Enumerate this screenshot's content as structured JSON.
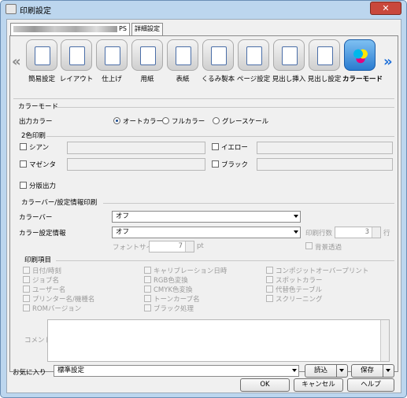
{
  "window": {
    "title": "印刷設定",
    "close_label": "✕"
  },
  "tabs": [
    {
      "label": "PS"
    },
    {
      "label": "詳細設定"
    }
  ],
  "icon_bar": {
    "items": [
      {
        "label": "簡易設定"
      },
      {
        "label": "レイアウト"
      },
      {
        "label": "仕上げ"
      },
      {
        "label": "用紙"
      },
      {
        "label": "表紙"
      },
      {
        "label": "くるみ製本"
      },
      {
        "label": "ページ設定"
      },
      {
        "label": "見出し挿入"
      },
      {
        "label": "見出し設定"
      },
      {
        "label": "カラーモード",
        "selected": true
      }
    ],
    "left_arrow": "«",
    "right_arrow": "»"
  },
  "color_mode": {
    "section": "カラーモード",
    "output_label": "出力カラー",
    "options": [
      "オートカラー",
      "フルカラー",
      "グレースケール"
    ],
    "selected": "オートカラー"
  },
  "two_color": {
    "section": "2色印刷",
    "cyan": "シアン",
    "yellow": "イエロー",
    "magenta": "マゼンタ",
    "black": "ブラック"
  },
  "split_output": "分版出力",
  "colorbar": {
    "section": "カラーバー/設定情報印刷",
    "bar_label": "カラーバー",
    "bar_value": "オフ",
    "info_label": "カラー設定情報",
    "info_value": "オフ",
    "lines_label": "印刷行数",
    "lines_value": "3",
    "lines_unit": "行",
    "font_label": "フォントサイズ",
    "font_value": "7",
    "font_unit": "pt",
    "bg_transparent": "背景透過"
  },
  "print_items": {
    "section": "印刷項目",
    "col1": [
      "日付/時刻",
      "ジョブ名",
      "ユーザー名",
      "プリンター名/機種名",
      "ROMバージョン"
    ],
    "col2": [
      "キャリブレーション日時",
      "RGB色変換",
      "CMYK色変換",
      "トーンカーブ名",
      "ブラック処理"
    ],
    "col3": [
      "コンポジットオーバープリント",
      "スポットカラー",
      "代替色テーブル",
      "スクリーニング"
    ],
    "comment_label": "コメント"
  },
  "favorites": {
    "label": "お気に入り",
    "value": "標準設定",
    "load": "読込",
    "save": "保存"
  },
  "buttons": {
    "ok": "OK",
    "cancel": "キャンセル",
    "help": "ヘルプ"
  }
}
